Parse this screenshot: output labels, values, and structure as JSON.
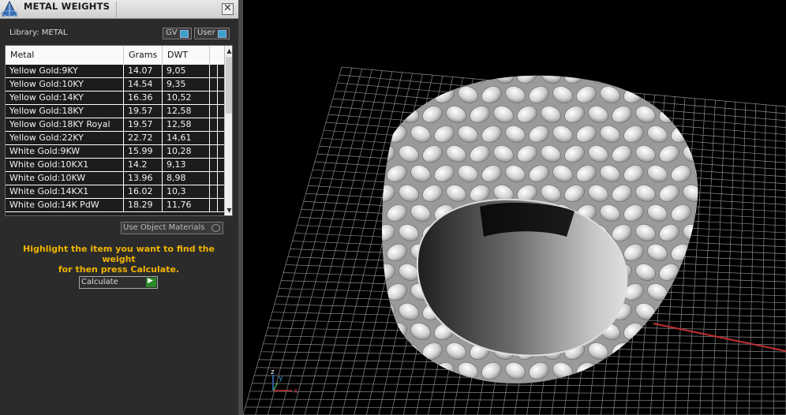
{
  "panel": {
    "title": "METAL WEIGHTS",
    "close_glyph": "✕",
    "library_label": "Library: METAL",
    "toggles": {
      "gv": "GV",
      "user": "User"
    },
    "columns": [
      "Metal",
      "Grams",
      "DWT"
    ],
    "rows": [
      {
        "metal": "Yellow Gold:9KY",
        "grams": "14.07",
        "dwt": "9,05"
      },
      {
        "metal": "Yellow Gold:10KY",
        "grams": "14.54",
        "dwt": "9,35"
      },
      {
        "metal": "Yellow Gold:14KY",
        "grams": "16.36",
        "dwt": "10,52"
      },
      {
        "metal": "Yellow Gold:18KY",
        "grams": "19.57",
        "dwt": "12,58"
      },
      {
        "metal": "Yellow Gold:18KY Royal",
        "grams": "19.57",
        "dwt": "12,58"
      },
      {
        "metal": "Yellow Gold:22KY",
        "grams": "22.72",
        "dwt": "14,61"
      },
      {
        "metal": "White Gold:9KW",
        "grams": "15.99",
        "dwt": "10,28"
      },
      {
        "metal": "White Gold:10KX1",
        "grams": "14.2",
        "dwt": "9,13"
      },
      {
        "metal": "White Gold:10KW",
        "grams": "13.96",
        "dwt": "8,98"
      },
      {
        "metal": "White Gold:14KX1",
        "grams": "16.02",
        "dwt": "10,3"
      },
      {
        "metal": "White Gold:14K PdW",
        "grams": "18.29",
        "dwt": "11,76"
      }
    ],
    "use_object_materials": "Use Object Materials",
    "instructions": [
      "Highlight the item you want to find the weight",
      "for then press Calculate."
    ],
    "calculate_label": "Calculate",
    "accent_color": "#f0b400"
  },
  "viewport": {
    "axis_labels": {
      "x": "x",
      "y": "y",
      "z": "z"
    },
    "background": "#000000",
    "grid_color": "#8a8a8a"
  },
  "icons": [
    "app-logo-icon",
    "close-icon",
    "chevron-up-icon",
    "chevron-down-icon",
    "play-icon"
  ]
}
